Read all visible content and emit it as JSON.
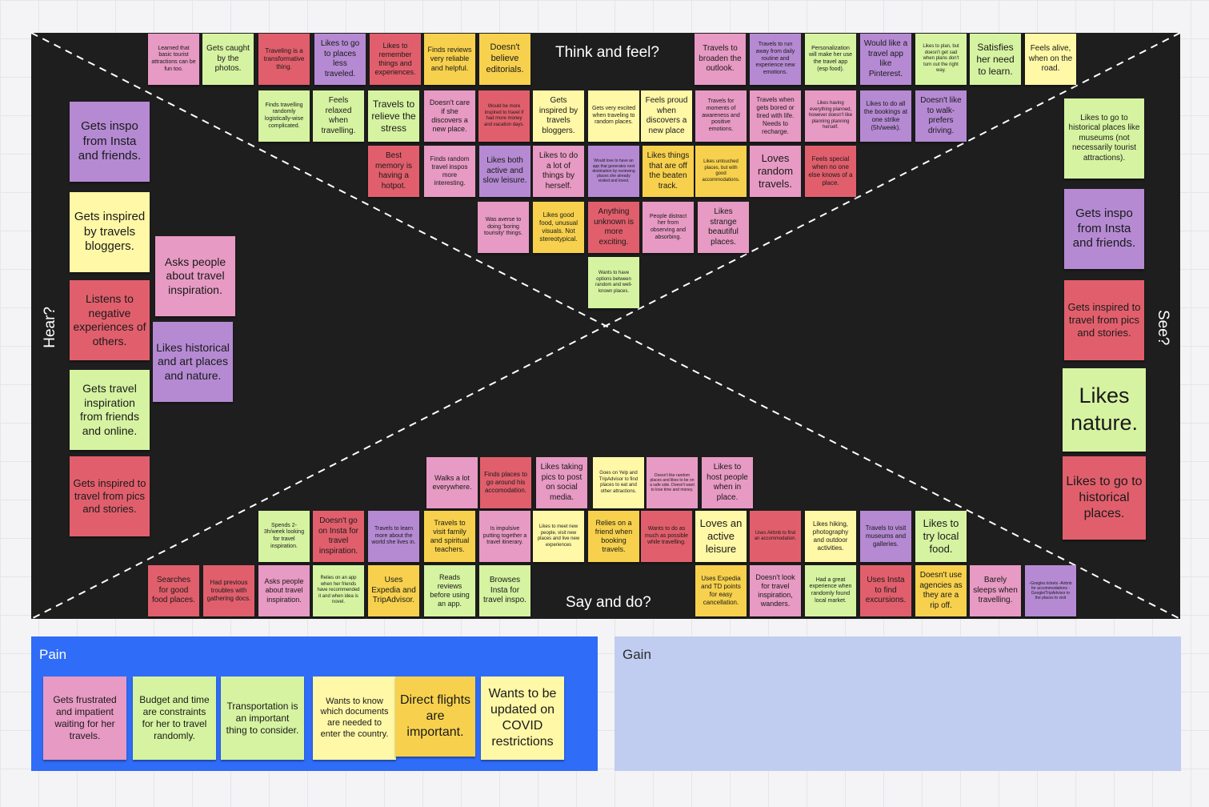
{
  "canvas": {
    "quadrant_labels": {
      "top": "Think and feel?",
      "bottom": "Say and do?",
      "left": "Hear?",
      "right": "See?"
    },
    "pain_title": "Pain",
    "gain_title": "Gain"
  },
  "notes": [
    {
      "text": "Learned that basic tourist attractions can be fun too.",
      "color": "pink",
      "section": "think"
    },
    {
      "text": "Gets caught by the photos.",
      "color": "green",
      "section": "think"
    },
    {
      "text": "Traveling is a transformative thing.",
      "color": "red",
      "section": "think"
    },
    {
      "text": "Likes to go to places less traveled.",
      "color": "purple",
      "section": "think"
    },
    {
      "text": "Likes to remember things and experiences.",
      "color": "red",
      "section": "think"
    },
    {
      "text": "Finds reviews very reliable and helpful.",
      "color": "yellow",
      "section": "think"
    },
    {
      "text": "Doesn't believe editorials.",
      "color": "yellow",
      "section": "think"
    },
    {
      "text": "Travels to broaden the outlook.",
      "color": "pink",
      "section": "think"
    },
    {
      "text": "Travels to run away from daily routine and experience new emotions.",
      "color": "purple",
      "section": "think"
    },
    {
      "text": "Personalization will make her use the travel app (esp food).",
      "color": "green",
      "section": "think"
    },
    {
      "text": "Would like a travel app like Pinterest.",
      "color": "purple",
      "section": "think"
    },
    {
      "text": "Likes to plan, but doesn't get sad when plans don't turn out the right way.",
      "color": "green",
      "section": "think"
    },
    {
      "text": "Satisfies her need to learn.",
      "color": "green",
      "section": "think"
    },
    {
      "text": "Feels alive, when on the road.",
      "color": "cream",
      "section": "think"
    },
    {
      "text": "Finds travelling randomly logistically-wise complicated.",
      "color": "green",
      "section": "think"
    },
    {
      "text": "Feels relaxed when travelling.",
      "color": "green",
      "section": "think"
    },
    {
      "text": "Travels to relieve the stress",
      "color": "green",
      "section": "think"
    },
    {
      "text": "Doesn't care if she discovers a new place.",
      "color": "pink",
      "section": "think"
    },
    {
      "text": "Would be more inspired to travel if had more money and vacation days.",
      "color": "red",
      "section": "think"
    },
    {
      "text": "Gets inspired by travels bloggers.",
      "color": "cream",
      "section": "think"
    },
    {
      "text": "Gets very excited when traveling to random places.",
      "color": "cream",
      "section": "think"
    },
    {
      "text": "Feels proud when discovers a new place",
      "color": "cream",
      "section": "think"
    },
    {
      "text": "Travels for moments of awareness and positive emotions.",
      "color": "pink",
      "section": "think"
    },
    {
      "text": "Travels when gets bored or tired with life. Needs to recharge.",
      "color": "pink",
      "section": "think"
    },
    {
      "text": "Likes having everything planned, however doesn't like planning planning herself.",
      "color": "pink",
      "section": "think"
    },
    {
      "text": "Likes to do all the bookings at one strike (5h/week).",
      "color": "purple",
      "section": "think"
    },
    {
      "text": "Doesn't like to walk-prefers driving.",
      "color": "purple",
      "section": "think"
    },
    {
      "text": "Best memory is having a hotpot.",
      "color": "red",
      "section": "think"
    },
    {
      "text": "Finds random travel inspos more interesting.",
      "color": "pink",
      "section": "think"
    },
    {
      "text": "Likes both active and slow leisure.",
      "color": "purple",
      "section": "think"
    },
    {
      "text": "Likes to do a lot of things by herself.",
      "color": "pink",
      "section": "think"
    },
    {
      "text": "Would love to have an app that generates next destination by reviewing places she already visited and loved.",
      "color": "purple",
      "section": "think"
    },
    {
      "text": "Likes things that are off the beaten track.",
      "color": "yellow",
      "section": "think"
    },
    {
      "text": "Likes untouched places, but with good accommodations.",
      "color": "yellow",
      "section": "think"
    },
    {
      "text": "Loves random travels.",
      "color": "pink",
      "section": "think"
    },
    {
      "text": "Feels special when no one else knows of a place.",
      "color": "red",
      "section": "think"
    },
    {
      "text": "Was averse to doing 'boring tourisity' things.",
      "color": "pink",
      "section": "think"
    },
    {
      "text": "Likes good food, unusual visuals. Not stereotypical.",
      "color": "yellow",
      "section": "think"
    },
    {
      "text": "Anything unknown is more exciting.",
      "color": "red",
      "section": "think"
    },
    {
      "text": "People distract her from observing and absorbing.",
      "color": "pink",
      "section": "think"
    },
    {
      "text": "Likes strange beautiful places.",
      "color": "pink",
      "section": "think"
    },
    {
      "text": "Wants to have options between random and well-known places.",
      "color": "green",
      "section": "think"
    },
    {
      "text": "Gets inspo from Insta and friends.",
      "color": "purple",
      "section": "hear"
    },
    {
      "text": "Gets inspired by travels bloggers.",
      "color": "cream",
      "section": "hear"
    },
    {
      "text": "Asks people about travel inspiration.",
      "color": "pink",
      "section": "hear"
    },
    {
      "text": "Listens to negative experiences of others.",
      "color": "red",
      "section": "hear"
    },
    {
      "text": "Likes historical and art places and nature.",
      "color": "purple",
      "section": "hear"
    },
    {
      "text": "Gets travel inspiration from friends and online.",
      "color": "green",
      "section": "hear"
    },
    {
      "text": "Gets inspired to travel from pics and stories.",
      "color": "red",
      "section": "hear"
    },
    {
      "text": "Likes to go to historical places like museums (not necessarily tourist attractions).",
      "color": "green",
      "section": "see"
    },
    {
      "text": "Gets inspo from Insta and friends.",
      "color": "purple",
      "section": "see"
    },
    {
      "text": "Gets inspired to travel from pics and stories.",
      "color": "red",
      "section": "see"
    },
    {
      "text": "Likes nature.",
      "color": "green",
      "section": "see"
    },
    {
      "text": "Likes to go to historical places.",
      "color": "red",
      "section": "see"
    },
    {
      "text": "Walks a lot everywhere.",
      "color": "pink",
      "section": "do"
    },
    {
      "text": "Finds places to go around his accomodation.",
      "color": "red",
      "section": "do"
    },
    {
      "text": "Likes taking pics to post on social media.",
      "color": "pink",
      "section": "do"
    },
    {
      "text": "Goes on Yelp and TripAdvisor to find places to eat and other attractions.",
      "color": "cream",
      "section": "do"
    },
    {
      "text": "Doesn't like random places and likes to be on a safe side. Doesn't want to lose time and money.",
      "color": "pink",
      "section": "do"
    },
    {
      "text": "Likes to host people when in place.",
      "color": "pink",
      "section": "do"
    },
    {
      "text": "Spends 2-3h/week looking for travel inspiration.",
      "color": "green",
      "section": "do"
    },
    {
      "text": "Doesn't go on Insta for travel inspiration.",
      "color": "red",
      "section": "do"
    },
    {
      "text": "Travels to learn more about the world she lives in.",
      "color": "purple",
      "section": "do"
    },
    {
      "text": "Travels to visit family and spiritual teachers.",
      "color": "yellow",
      "section": "do"
    },
    {
      "text": "Is impulsive putting together a travel itinerary.",
      "color": "pink",
      "section": "do"
    },
    {
      "text": "Likes to meet new people, visit new places and live new experiences",
      "color": "cream",
      "section": "do"
    },
    {
      "text": "Relies on a friend when booking travels.",
      "color": "yellow",
      "section": "do"
    },
    {
      "text": "Wants to do as much as possible while travelling.",
      "color": "red",
      "section": "do"
    },
    {
      "text": "Loves an active leisure",
      "color": "cream",
      "section": "do"
    },
    {
      "text": "Uses Airbnb to find an accommodation.",
      "color": "red",
      "section": "do"
    },
    {
      "text": "Likes hiking, photography and outdoor activities.",
      "color": "cream",
      "section": "do"
    },
    {
      "text": "Travels to visit museums and galleries.",
      "color": "purple",
      "section": "do"
    },
    {
      "text": "Likes to try local food.",
      "color": "green",
      "section": "do"
    },
    {
      "text": "Searches for good food places.",
      "color": "red",
      "section": "do"
    },
    {
      "text": "Had previous troubles with gathering docs.",
      "color": "red",
      "section": "do"
    },
    {
      "text": "Asks people about travel inspiration.",
      "color": "pink",
      "section": "do"
    },
    {
      "text": "Relies on an app when her friends have recommended it and when idea is novel.",
      "color": "green",
      "section": "do"
    },
    {
      "text": "Uses Expedia and TripAdvisor.",
      "color": "yellow",
      "section": "do"
    },
    {
      "text": "Reads reviews before using an app.",
      "color": "green",
      "section": "do"
    },
    {
      "text": "Browses Insta for travel inspo.",
      "color": "green",
      "section": "do"
    },
    {
      "text": "Uses Expedia and TD points for easy cancellation.",
      "color": "yellow",
      "section": "do"
    },
    {
      "text": "Doesn't look for travel inspiration, wanders.",
      "color": "pink",
      "section": "do"
    },
    {
      "text": "Had a great experience when randomly found local market.",
      "color": "green",
      "section": "do"
    },
    {
      "text": "Uses Insta to find excursions.",
      "color": "red",
      "section": "do"
    },
    {
      "text": "Doesn't use agencies as they are a rip off.",
      "color": "yellow",
      "section": "do"
    },
    {
      "text": "Barely sleeps when travelling.",
      "color": "pink",
      "section": "do"
    },
    {
      "text": "-Googles tickets -Airbnb for accommodations -Google/TripAdvisor to the places to visit",
      "color": "purple",
      "section": "do"
    },
    {
      "text": "Gets frustrated and impatient waiting for her travels.",
      "color": "pink",
      "section": "pain"
    },
    {
      "text": "Budget and time are constraints for her to travel randomly.",
      "color": "green",
      "section": "pain"
    },
    {
      "text": "Transportation is an important thing to consider.",
      "color": "green",
      "section": "pain"
    },
    {
      "text": "Wants to know which documents are needed to enter the country.",
      "color": "cream",
      "section": "pain"
    },
    {
      "text": "Direct flights are important.",
      "color": "yellow",
      "section": "pain"
    },
    {
      "text": "Wants to be updated on COVID restrictions",
      "color": "cream",
      "section": "pain"
    }
  ]
}
